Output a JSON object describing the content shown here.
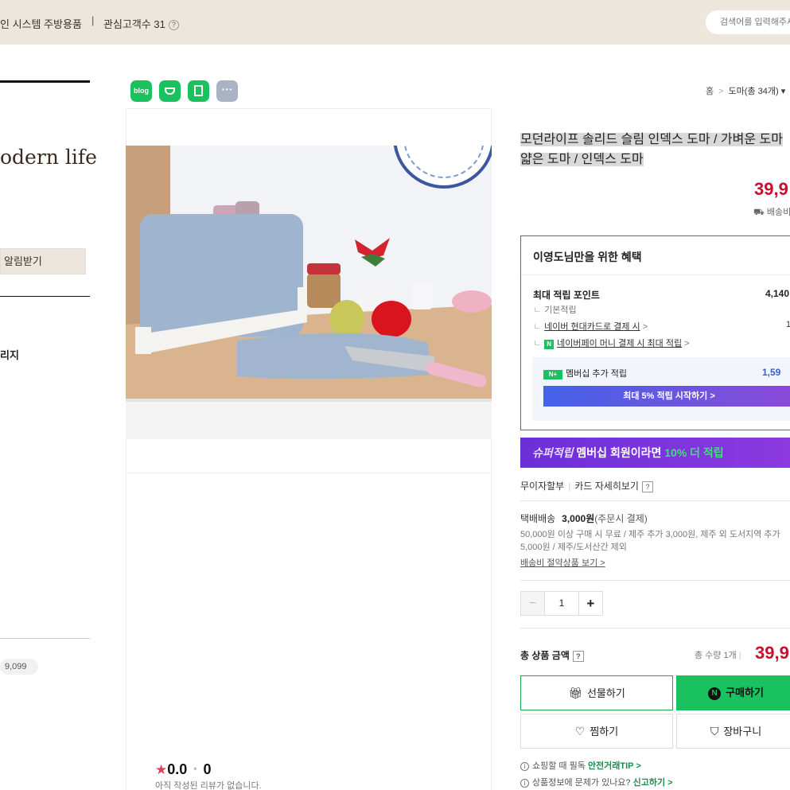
{
  "topbar": {
    "crumb": "인 시스템 주방용품",
    "separator": "|",
    "interest": "관심고객수 31",
    "help": "?",
    "search_placeholder": "검색어를 입력해주세요"
  },
  "left": {
    "brand": "odern life",
    "notify_button": "알림받기",
    "menu_item": "리지",
    "visitor": "9,099"
  },
  "share": {
    "blog": "blog",
    "more": "···"
  },
  "breadcrumb": {
    "home": "홈",
    "arrow": ">",
    "category": "도마(총 34개)",
    "caret": "▾"
  },
  "product": {
    "title_line1": "모던라이프 솔리드 슬림 인덱스 도마 / 가벼운 도마",
    "title_line2": "얇은 도마 / 인덱스 도마",
    "price": "39,9",
    "shipping_label": "배송비"
  },
  "benefit": {
    "title": "이영도님만을 위한 혜택",
    "max_point_label": "최대 적립 포인트",
    "max_point_value": "4,140",
    "basic_label": "기본적립",
    "card_link": "네이버 현대카드로 결제 시",
    "card_arrow": ">",
    "card_value": "1",
    "npay_badge": "N",
    "npay_link": "네이버페이 머니 결제 시 최대 적립",
    "npay_arrow": ">",
    "member_badge": "N+",
    "member_label": "멤버십 추가 적립",
    "member_value": "1,59",
    "member_button": "최대 5% 적립 시작하기 >"
  },
  "super_banner": {
    "em": "슈퍼적립",
    "text": " 멤버십 회원이라면 ",
    "highlight": "10% 더 적립"
  },
  "card_row": {
    "interest_free": "무이자할부",
    "bar": "|",
    "card_detail": "카드 자세히보기",
    "help": "?"
  },
  "shipping": {
    "method": "택배배송",
    "fee": "3,000원",
    "fee_note": "(주문시 결제)",
    "desc": "50,000원 이상 구매 시 무료 / 제주 추가 3,000원, 제주 외 도서지역 추가 5,000원 / 제주/도서산간 제외",
    "saving_link": "배송비 절약상품 보기 >"
  },
  "quantity": {
    "minus": "−",
    "value": "1",
    "plus": "+"
  },
  "total": {
    "label": "총 상품 금액",
    "help": "?",
    "count": "총 수량 1개",
    "bar": "|",
    "price": "39,9"
  },
  "buttons": {
    "gift": "선물하기",
    "buy": "구매하기",
    "buy_badge": "N",
    "wish": "찜하기",
    "cart": "장바구니"
  },
  "tips": {
    "tip1_text": "쇼핑할 때 필독",
    "tip1_link": "안전거래TIP >",
    "tip2_text": "상품정보에 문제가 있나요?",
    "tip2_link": "신고하기 >",
    "info_icon": "i"
  },
  "review": {
    "star": "★",
    "score": "0.0",
    "dot": "•",
    "count": "0",
    "empty_text": "아직 작성된 리뷰가 없습니다."
  },
  "colors": {
    "accent_green": "#19c15f",
    "price_red": "#c8102e",
    "membership_purple": "#6b2fd8",
    "topbar_beige": "#ede6dc"
  }
}
